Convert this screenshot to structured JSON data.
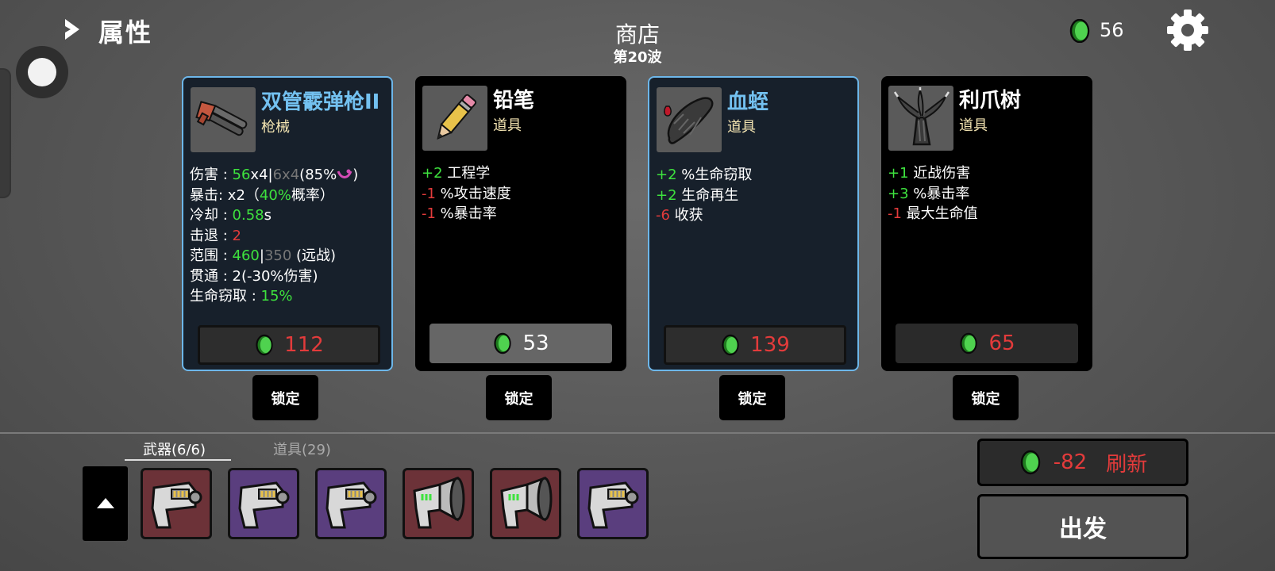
{
  "header": {
    "stats_label": "属性",
    "shop_title": "商店",
    "wave": "第20波",
    "materials": "56"
  },
  "colors": {
    "positive": "#3ee23e",
    "negative": "#e33b3b",
    "selected_border": "#6db7ea",
    "item_type": "#f4e5b2",
    "tier_red": "#6c3238",
    "tier_purple": "#5a3e7e"
  },
  "cards": [
    {
      "name": "双管霰弹枪II",
      "type": "枪械",
      "selected": true,
      "icon": "double-barrel-shotgun-icon",
      "price": "112",
      "lock": "锁定",
      "weapon_stats": {
        "damage_label": "伤害 : ",
        "damage_value": "56",
        "damage_mult": "x4",
        "damage_sep": "|",
        "damage_base": "6x4",
        "damage_scaling": "(85%",
        "damage_close": ")",
        "crit_label": "暴击: ",
        "crit_mult": "x2（",
        "crit_chance": "40%",
        "crit_suffix": "概率）",
        "cooldown_label": "冷却 : ",
        "cooldown_value": "0.58",
        "cooldown_unit": "s",
        "knockback_label": "击退 : ",
        "knockback_value": "2",
        "range_label": "范围 : ",
        "range_value": "460",
        "range_sep": "|",
        "range_base": "350",
        "range_suffix": " (远战)",
        "pierce_label": "贯通 : ",
        "pierce_value": "2(-30%伤害)",
        "lifesteal_label": "生命窃取 : ",
        "lifesteal_value": "15%"
      }
    },
    {
      "name": "铅笔",
      "type": "道具",
      "selected": false,
      "icon": "pencil-icon",
      "price": "53",
      "lock": "锁定",
      "effects": [
        {
          "value": "+2",
          "sign": "positive",
          "stat": " 工程学"
        },
        {
          "value": "-1",
          "sign": "negative",
          "stat": " %攻击速度"
        },
        {
          "value": "-1",
          "sign": "negative",
          "stat": " %暴击率"
        }
      ]
    },
    {
      "name": "血蛭",
      "type": "道具",
      "selected": true,
      "icon": "leech-icon",
      "price": "139",
      "lock": "锁定",
      "effects": [
        {
          "value": "+2",
          "sign": "positive",
          "stat": " %生命窃取"
        },
        {
          "value": "+2",
          "sign": "positive",
          "stat": " 生命再生"
        },
        {
          "value": "-6",
          "sign": "negative",
          "stat": " 收获"
        }
      ]
    },
    {
      "name": "利爪树",
      "type": "道具",
      "selected": false,
      "icon": "claw-tree-icon",
      "price": "65",
      "lock": "锁定",
      "effects": [
        {
          "value": "+1",
          "sign": "positive",
          "stat": " 近战伤害"
        },
        {
          "value": "+3",
          "sign": "positive",
          "stat": " %暴击率"
        },
        {
          "value": "-1",
          "sign": "negative",
          "stat": " 最大生命值"
        }
      ]
    }
  ],
  "inventory": {
    "weapons_tab": "武器(6/6)",
    "items_tab": "道具(29)",
    "weapons": [
      {
        "tier": "red",
        "icon": "taser-gun-icon"
      },
      {
        "tier": "purple",
        "icon": "taser-gun-icon"
      },
      {
        "tier": "purple",
        "icon": "taser-gun-icon"
      },
      {
        "tier": "red",
        "icon": "megaphone-gun-icon"
      },
      {
        "tier": "red",
        "icon": "megaphone-gun-icon"
      },
      {
        "tier": "purple",
        "icon": "taser-gun-icon"
      }
    ]
  },
  "actions": {
    "reroll_cost": "-82",
    "reroll_label": "刷新",
    "go_label": "出发"
  }
}
